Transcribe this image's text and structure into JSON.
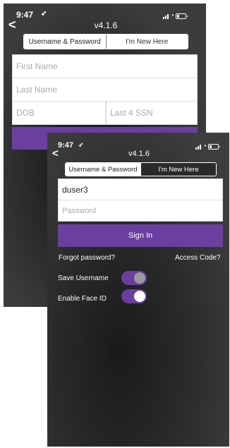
{
  "signup_screen": {
    "status_time": "9:47",
    "version": "v4.1.6",
    "tabs": [
      "Username & Password",
      "I'm New Here"
    ],
    "fields": {
      "first_name_placeholder": "First Name",
      "last_name_placeholder": "Last Name",
      "dob_placeholder": "DOB",
      "ssn_placeholder": "Last 4 SSN"
    }
  },
  "login_screen": {
    "status_time": "9:47",
    "version": "v4.1.6",
    "tabs": [
      "Username & Password",
      "I'm New Here"
    ],
    "username_value": "duser3",
    "password_placeholder": "Password",
    "sign_in_label": "Sign In",
    "forgot_password_label": "Forgot password?",
    "access_code_label": "Access Code?",
    "save_username_label": "Save Username",
    "save_username_on": false,
    "enable_face_id_label": "Enable Face ID",
    "enable_face_id_on": true
  },
  "colors": {
    "accent": "#6b3fa0",
    "background": "#3a3a3a"
  }
}
